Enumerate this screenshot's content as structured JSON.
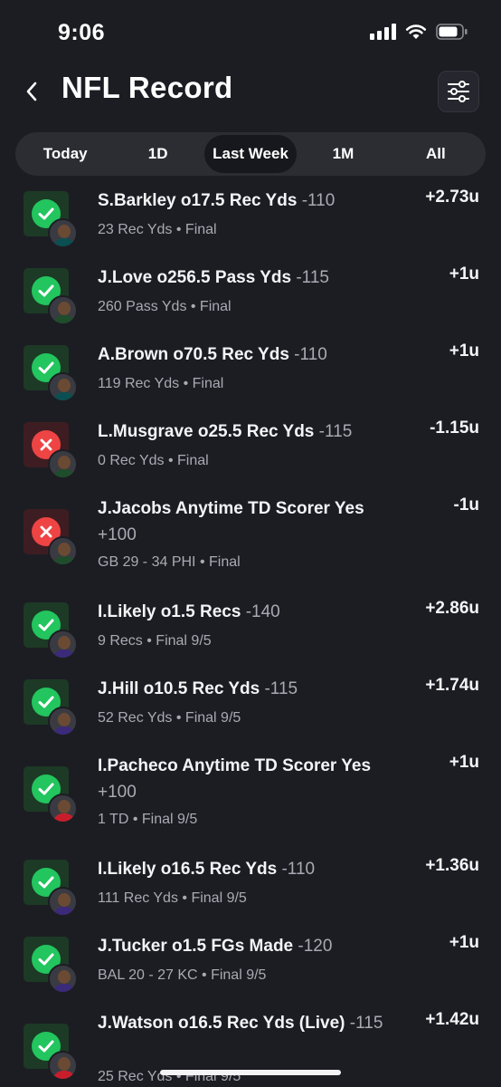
{
  "status_bar": {
    "time": "9:06"
  },
  "header": {
    "title": "NFL Record"
  },
  "tabs": [
    {
      "label": "Today",
      "active": false
    },
    {
      "label": "1D",
      "active": false
    },
    {
      "label": "Last Week",
      "active": true
    },
    {
      "label": "1M",
      "active": false
    },
    {
      "label": "All",
      "active": false
    }
  ],
  "colors": {
    "background": "#1c1d23",
    "win_green": "#22c55e",
    "loss_red": "#ef4444",
    "muted_text": "#a8abb3"
  },
  "picks": [
    {
      "status": "won",
      "player": "S.Barkley o17.5 Rec Yds",
      "odds": "-110",
      "detail": "23 Rec Yds • Final",
      "result": "+2.73u",
      "jersey": "#0b4f52"
    },
    {
      "status": "won",
      "player": "J.Love o256.5 Pass Yds",
      "odds": "-115",
      "detail": "260 Pass Yds • Final",
      "result": "+1u",
      "jersey": "#1f4d2b"
    },
    {
      "status": "won",
      "player": "A.Brown o70.5 Rec Yds",
      "odds": "-110",
      "detail": "119 Rec Yds • Final",
      "result": "+1u",
      "jersey": "#0b4f52"
    },
    {
      "status": "lost",
      "player": "L.Musgrave o25.5 Rec Yds",
      "odds": "-115",
      "detail": "0 Rec Yds • Final",
      "result": "-1.15u",
      "jersey": "#1f4d2b"
    },
    {
      "status": "lost",
      "player": "J.Jacobs Anytime TD Scorer Yes",
      "odds": "+100",
      "detail": "GB 29 - 34 PHI • Final",
      "result": "-1u",
      "jersey": "#1f4d2b"
    },
    {
      "status": "won",
      "player": "I.Likely o1.5 Recs",
      "odds": "-140",
      "detail": "9 Recs • Final 9/5",
      "result": "+2.86u",
      "jersey": "#3b2a7a"
    },
    {
      "status": "won",
      "player": "J.Hill o10.5 Rec Yds",
      "odds": "-115",
      "detail": "52 Rec Yds • Final 9/5",
      "result": "+1.74u",
      "jersey": "#3b2a7a"
    },
    {
      "status": "won",
      "player": "I.Pacheco Anytime TD Scorer Yes",
      "odds": "+100",
      "detail": "1 TD • Final 9/5",
      "result": "+1u",
      "jersey": "#c81e2c"
    },
    {
      "status": "won",
      "player": "I.Likely o16.5 Rec Yds",
      "odds": "-110",
      "detail": "111 Rec Yds • Final 9/5",
      "result": "+1.36u",
      "jersey": "#3b2a7a"
    },
    {
      "status": "won",
      "player": "J.Tucker o1.5 FGs Made",
      "odds": "-120",
      "detail": "BAL 20 - 27 KC • Final 9/5",
      "result": "+1u",
      "jersey": "#3b2a7a"
    },
    {
      "status": "won",
      "player": "J.Watson o16.5 Rec Yds (Live)",
      "odds": "-115",
      "detail": "25 Rec Yds • Final 9/5",
      "result": "+1.42u",
      "jersey": "#c81e2c"
    }
  ]
}
